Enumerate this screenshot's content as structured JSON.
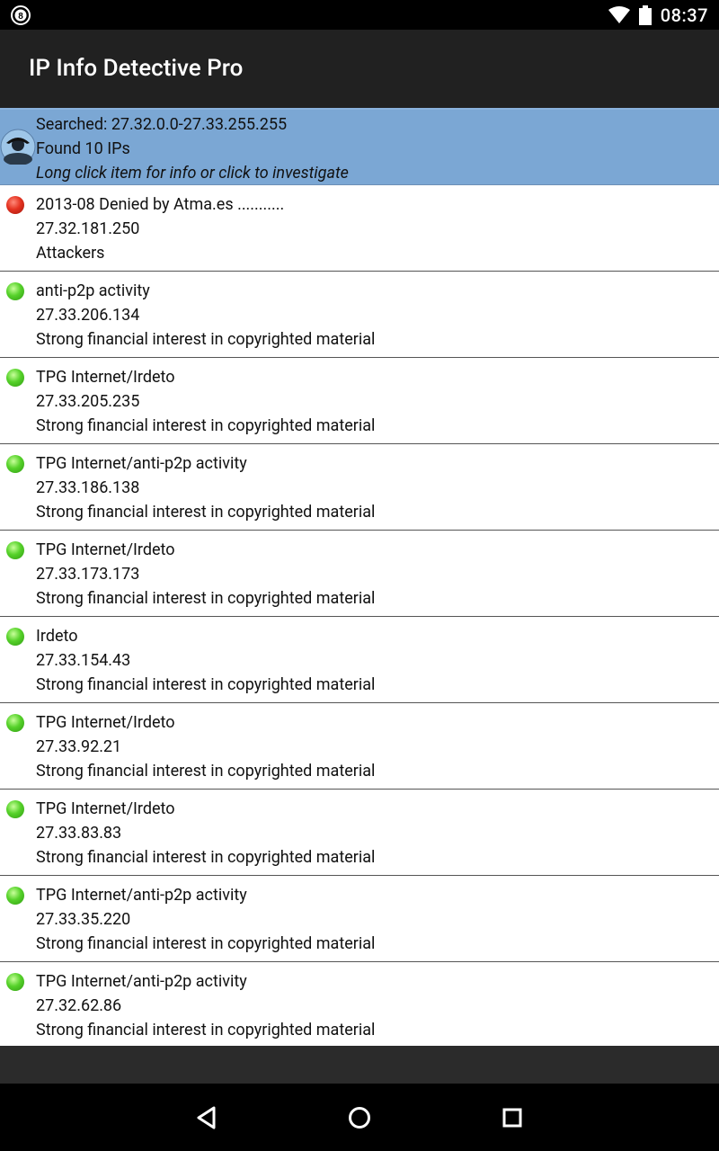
{
  "status_bar": {
    "time": "08:37",
    "left_icon": "notification-8-icon",
    "right_icons": [
      "wifi-icon",
      "battery-icon"
    ]
  },
  "app": {
    "title": "IP Info Detective Pro"
  },
  "header": {
    "searched": "Searched: 27.32.0.0-27.33.255.255",
    "found": "Found 10 IPs",
    "hint": "Long click item for info or click to investigate",
    "icon": "detective-avatar-icon"
  },
  "items": [
    {
      "status": "red",
      "title": "2013-08 Denied by Atma.es ...........",
      "ip": "27.32.181.250",
      "category": "Attackers"
    },
    {
      "status": "green",
      "title": "anti-p2p activity",
      "ip": "27.33.206.134",
      "category": "Strong financial interest in copyrighted material"
    },
    {
      "status": "green",
      "title": "TPG Internet/Irdeto",
      "ip": "27.33.205.235",
      "category": "Strong financial interest in copyrighted material"
    },
    {
      "status": "green",
      "title": "TPG Internet/anti-p2p activity",
      "ip": "27.33.186.138",
      "category": "Strong financial interest in copyrighted material"
    },
    {
      "status": "green",
      "title": "TPG Internet/Irdeto",
      "ip": "27.33.173.173",
      "category": "Strong financial interest in copyrighted material"
    },
    {
      "status": "green",
      "title": "Irdeto",
      "ip": "27.33.154.43",
      "category": "Strong financial interest in copyrighted material"
    },
    {
      "status": "green",
      "title": "TPG Internet/Irdeto",
      "ip": "27.33.92.21",
      "category": "Strong financial interest in copyrighted material"
    },
    {
      "status": "green",
      "title": "TPG Internet/Irdeto",
      "ip": "27.33.83.83",
      "category": "Strong financial interest in copyrighted material"
    },
    {
      "status": "green",
      "title": "TPG Internet/anti-p2p activity",
      "ip": "27.33.35.220",
      "category": "Strong financial interest in copyrighted material"
    },
    {
      "status": "green",
      "title": "TPG Internet/anti-p2p activity",
      "ip": "27.32.62.86",
      "category": "Strong financial interest in copyrighted material"
    }
  ],
  "nav": {
    "back_icon": "back-triangle-icon",
    "home_icon": "home-circle-icon",
    "recents_icon": "recents-square-icon"
  }
}
